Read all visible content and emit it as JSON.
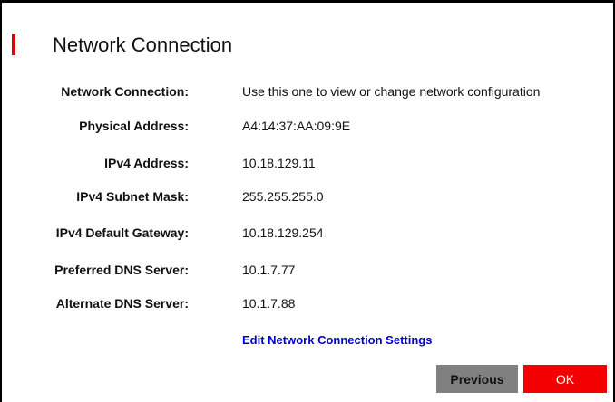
{
  "dialog": {
    "title": "Network Connection",
    "accent_color": "#e10000"
  },
  "fields": [
    {
      "label": "Network Connection:",
      "value": "Use this one to view or change network configuration"
    },
    {
      "label": "Physical Address:",
      "value": "A4:14:37:AA:09:9E"
    },
    {
      "label": "IPv4 Address:",
      "value": "10.18.129.11"
    },
    {
      "label": "IPv4 Subnet Mask:",
      "value": "255.255.255.0"
    },
    {
      "label": "IPv4 Default Gateway:",
      "value": "10.18.129.254"
    },
    {
      "label": "Preferred DNS Server:",
      "value": "10.1.7.77"
    },
    {
      "label": "Alternate DNS Server:",
      "value": "10.1.7.88"
    }
  ],
  "edit_link": "Edit Network Connection Settings",
  "buttons": {
    "previous_label": "Previous",
    "ok_label": "OK",
    "previous_color": "#808080",
    "ok_color": "#f40000"
  }
}
